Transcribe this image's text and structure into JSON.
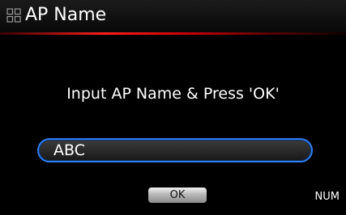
{
  "title": {
    "icon": "grid-icon",
    "text": "AP Name"
  },
  "prompt": "Input AP  Name & Press 'OK'",
  "input": {
    "value": "ABC"
  },
  "ok_button": {
    "label": "OK"
  },
  "mode_indicator": "NUM",
  "colors": {
    "background": "#000000",
    "title_underline": "#e01010",
    "input_border": "#2f7ff2",
    "text": "#ffffff"
  }
}
